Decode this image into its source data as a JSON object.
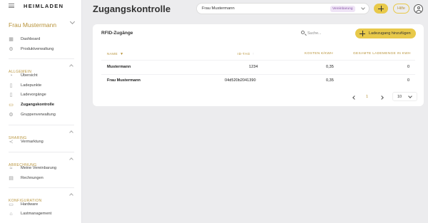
{
  "app": {
    "logo": "HEIMLADEN",
    "page_title": "Zugangskontrolle"
  },
  "sidebar": {
    "account_name": "Frau Mustermann",
    "top_items": [
      {
        "label": "Dashboard",
        "icon": "grid-icon"
      },
      {
        "label": "Produktverwaltung",
        "icon": "settings-icon"
      }
    ],
    "sections": [
      {
        "label": "ALLGEMEIN",
        "items": [
          {
            "label": "Übersicht",
            "icon": "gauge-icon"
          },
          {
            "label": "Ladepunkte",
            "icon": "charger-icon"
          },
          {
            "label": "Ladevorgänge",
            "icon": "battery-icon"
          },
          {
            "label": "Zugangskontrolle",
            "icon": "rfid-card-icon",
            "active": true
          },
          {
            "label": "Gruppenverwaltung",
            "icon": "group-icon"
          }
        ]
      },
      {
        "label": "SHARING",
        "items": [
          {
            "label": "Vermarktung",
            "icon": "share-icon"
          }
        ]
      },
      {
        "label": "ABRECHNUNG",
        "items": [
          {
            "label": "Meine Vereinbarung",
            "icon": "handshake-icon"
          },
          {
            "label": "Rechnungen",
            "icon": "invoice-icon"
          }
        ]
      },
      {
        "label": "KONFIGURATION",
        "items": [
          {
            "label": "Hardware",
            "icon": "hardware-icon"
          },
          {
            "label": "Lastmanagement",
            "icon": "load-icon"
          }
        ]
      }
    ]
  },
  "header": {
    "account_select_value": "Frau Mustermann",
    "agreement_badge": "Vereinbarung",
    "help_label": "Hilfe"
  },
  "card": {
    "title": "RFID-Zugänge",
    "search_placeholder": "Suche...",
    "add_button_label": "Ladezugang hinzufügen",
    "columns": [
      "NAME",
      "ID-TAG",
      "KOSTEN €/KWH",
      "GESAMTE LADEMENGE IN KWH"
    ],
    "rows": [
      [
        "Mustermann",
        "1234",
        "0,35",
        "0"
      ],
      [
        "Frau Mustermann",
        "04d520b2041390",
        "0,35",
        "0"
      ]
    ],
    "pagination": {
      "current_page": "1",
      "page_size": "10"
    }
  },
  "colors": {
    "accent": "#e8c94a",
    "accent_text": "#b8933a",
    "badge_bg": "#efe4f6"
  }
}
